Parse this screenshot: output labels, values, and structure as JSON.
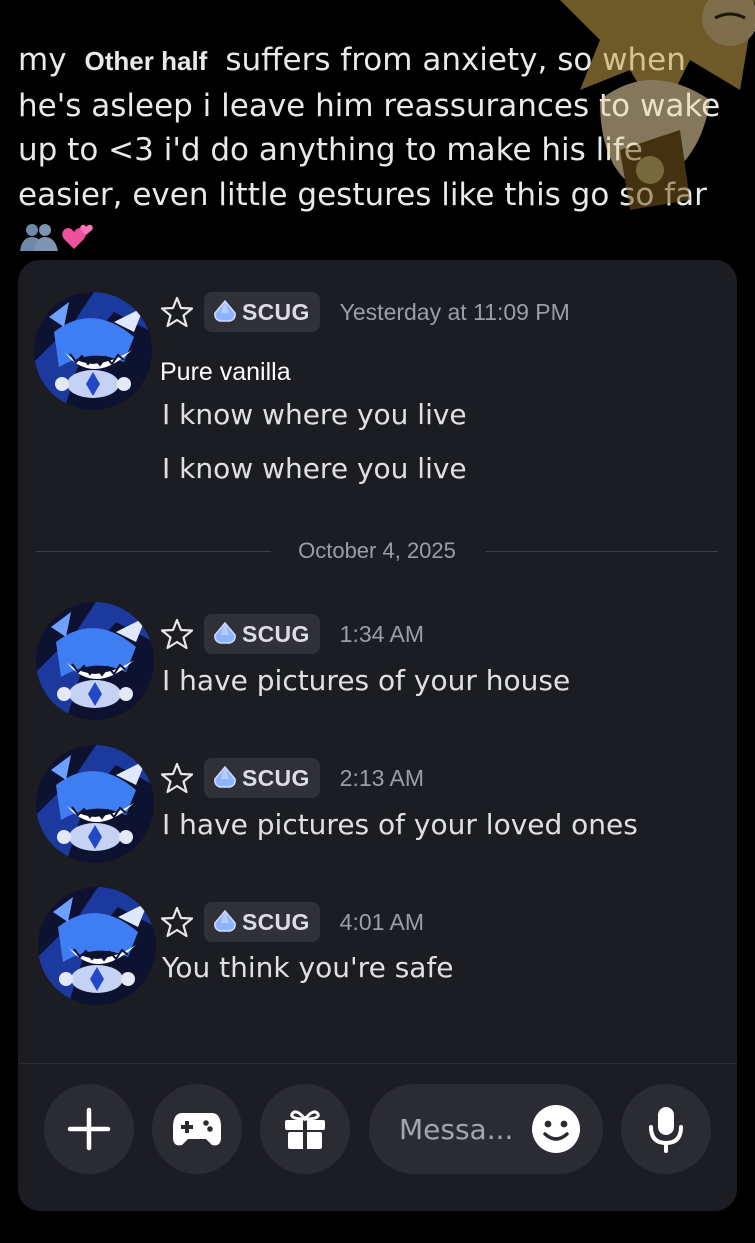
{
  "post": {
    "line1_pre": "my",
    "inserted_label": "Other half",
    "line1_post": "suffers from anxiety, so when he's asleep i leave him reassurances to wake up to <3 i'd do anything to make his life easier, even little gestures like this go so far"
  },
  "chat": {
    "messages": [
      {
        "tag": "SCUG",
        "time": "Yesterday at 11:09 PM",
        "reply": "Pure vanilla",
        "lines": [
          "I know where you live",
          "I know where you live"
        ]
      },
      {
        "tag": "SCUG",
        "time": "1:34 AM",
        "lines": [
          "I have pictures of your house"
        ]
      },
      {
        "tag": "SCUG",
        "time": "2:13 AM",
        "lines": [
          "I have pictures of your loved ones"
        ]
      },
      {
        "tag": "SCUG",
        "time": "4:01 AM",
        "lines": [
          "You think you're safe"
        ]
      }
    ],
    "date_divider": "October 4, 2025"
  },
  "composer": {
    "placeholder": "Messa..."
  },
  "colors": {
    "card_bg": "#1c1d22",
    "button_bg": "#2b2c33",
    "tag_icon": "#8fb4ff"
  },
  "icons": [
    "star-icon",
    "gem-tag-icon",
    "plus-icon",
    "gamepad-icon",
    "gift-icon",
    "emoji-icon",
    "microphone-icon"
  ]
}
